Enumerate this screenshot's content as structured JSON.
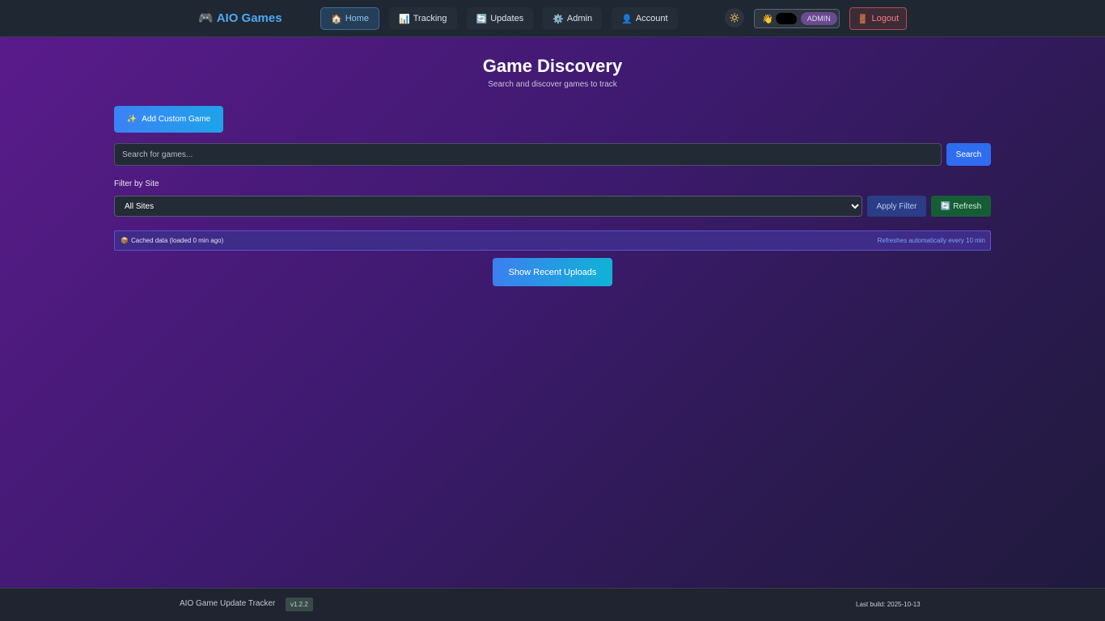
{
  "header": {
    "brand_icon": "🎮",
    "brand": "AIO Games",
    "nav": [
      {
        "icon": "🏠",
        "label": "Home",
        "active": true
      },
      {
        "icon": "📊",
        "label": "Tracking",
        "active": false
      },
      {
        "icon": "🔄",
        "label": "Updates",
        "active": false
      },
      {
        "icon": "⚙️",
        "label": "Admin",
        "active": false
      },
      {
        "icon": "👤",
        "label": "Account",
        "active": false
      }
    ],
    "user_wave": "👋",
    "role_badge": "ADMIN",
    "logout_icon": "🚪",
    "logout_label": "Logout"
  },
  "main": {
    "title": "Game Discovery",
    "subtitle": "Search and discover games to track",
    "add_custom_icon": "✨",
    "add_custom_label": "Add Custom Game",
    "search_placeholder": "Search for games...",
    "search_label": "Search",
    "filter_label": "Filter by Site",
    "site_selected": "All Sites",
    "apply_filter_label": "Apply Filter",
    "refresh_icon": "🔄",
    "refresh_label": "Refresh",
    "cache_icon": "📦",
    "cache_text": "Cached data (loaded 0 min ago)",
    "cache_refresh_note": "Refreshes automatically every 10 min",
    "recent_uploads_label": "Show Recent Uploads"
  },
  "footer": {
    "title": "AIO Game Update Tracker",
    "version": "v1.2.2",
    "build": "Last build: 2025-10-13"
  },
  "colors": {
    "accent": "#4fa8f0",
    "search_button": "#2e6df0",
    "refresh_button": "#165d36",
    "logout": "#f07b85"
  }
}
